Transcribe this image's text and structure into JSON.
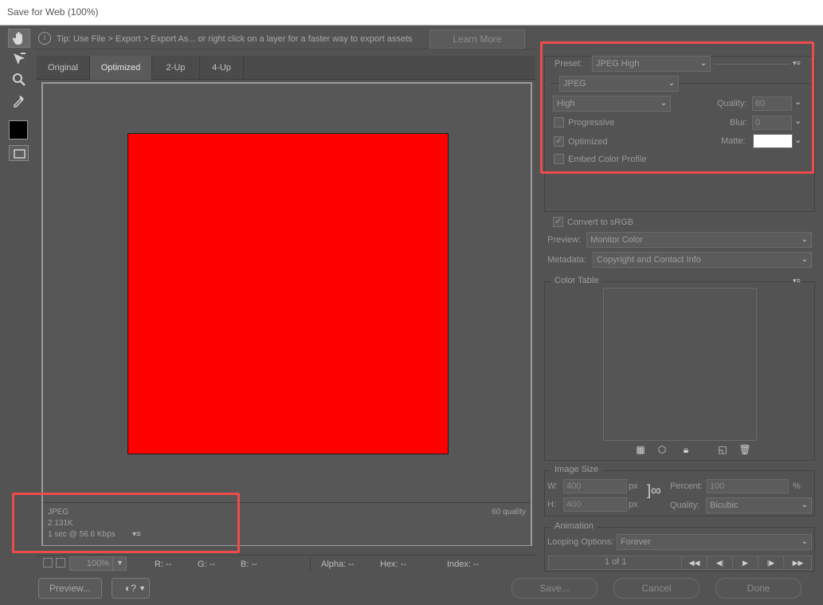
{
  "window": {
    "title": "Save for Web (100%)"
  },
  "tipbar": {
    "tip": "Tip: Use File > Export > Export As...  or right click on a layer for a faster way to export assets",
    "learn_more": "Learn More"
  },
  "tabs": [
    {
      "label": "Original"
    },
    {
      "label": "Optimized"
    },
    {
      "label": "2-Up"
    },
    {
      "label": "4-Up"
    }
  ],
  "active_tab": "Optimized",
  "preview": {
    "image_color": "#fe0000"
  },
  "info": {
    "format": "JPEG",
    "size": "2.131K",
    "time": "1 sec @ 56.6 Kbps",
    "quality": "60 quality"
  },
  "status": {
    "zoom": "100%",
    "r": "R: --",
    "g": "G: --",
    "b": "B: --",
    "alpha": "Alpha: --",
    "hex": "Hex: --",
    "index": "Index: --"
  },
  "buttons": {
    "preview": "Preview...",
    "save": "Save...",
    "cancel": "Cancel",
    "done": "Done"
  },
  "settings": {
    "preset_label": "Preset:",
    "preset": "JPEG High",
    "format": "JPEG",
    "quality_level": "High",
    "quality_label": "Quality:",
    "quality": "60",
    "blur_label": "Blur:",
    "blur": "0",
    "matte_label": "Matte:",
    "matte_color": "#ffffff",
    "progressive": "Progressive",
    "optimized": "Optimized",
    "embed_profile": "Embed Color Profile",
    "convert_srgb": "Convert to sRGB",
    "preview_label": "Preview:",
    "preview_value": "Monitor Color",
    "metadata_label": "Metadata:",
    "metadata_value": "Copyright and Contact Info"
  },
  "color_table": {
    "title": "Color Table"
  },
  "image_size": {
    "title": "Image Size",
    "w_label": "W:",
    "w": "400",
    "h_label": "H:",
    "h": "400",
    "unit": "px",
    "percent_label": "Percent:",
    "percent": "100",
    "percent_unit": "%",
    "quality_label": "Quality:",
    "quality": "Bicubic"
  },
  "animation": {
    "title": "Animation",
    "looping_label": "Looping Options:",
    "looping": "Forever",
    "frame": "1 of 1"
  },
  "highlight_color": "#ef4b4b"
}
